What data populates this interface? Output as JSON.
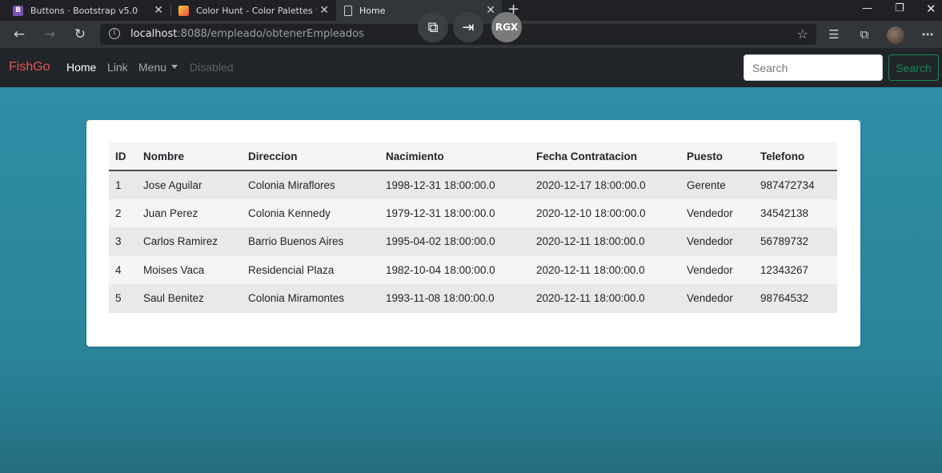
{
  "browser": {
    "tabs": [
      {
        "label": "Buttons · Bootstrap v5.0",
        "icon": "bootstrap-icon",
        "active": false
      },
      {
        "label": "Color Hunt - Color Palettes for D",
        "icon": "colorhunt-icon",
        "active": false
      },
      {
        "label": "Home",
        "icon": "page-icon",
        "active": true
      }
    ],
    "url_host": "localhost",
    "url_rest": ":8088/empleado/obtenerEmpleados",
    "overlay_rgx_label": "RGX"
  },
  "navbar": {
    "brand": "FishGo",
    "links": [
      "Home",
      "Link",
      "Menu",
      "Disabled"
    ],
    "search_placeholder": "Search",
    "search_button": "Search",
    "brand_color": "#e05757",
    "accent_color": "#198754"
  },
  "table": {
    "headers": [
      "ID",
      "Nombre",
      "Direccion",
      "Nacimiento",
      "Fecha Contratacion",
      "Puesto",
      "Telefono"
    ],
    "rows": [
      [
        "1",
        "Jose Aguilar",
        "Colonia Miraflores",
        "1998-12-31 18:00:00.0",
        "2020-12-17 18:00:00.0",
        "Gerente",
        "987472734"
      ],
      [
        "2",
        "Juan Perez",
        "Colonia Kennedy",
        "1979-12-31 18:00:00.0",
        "2020-12-10 18:00:00.0",
        "Vendedor",
        "34542138"
      ],
      [
        "3",
        "Carlos Ramirez",
        "Barrio Buenos Aires",
        "1995-04-02 18:00:00.0",
        "2020-12-11 18:00:00.0",
        "Vendedor",
        "56789732"
      ],
      [
        "4",
        "Moises Vaca",
        "Residencial Plaza",
        "1982-10-04 18:00:00.0",
        "2020-12-11 18:00:00.0",
        "Vendedor",
        "12343267"
      ],
      [
        "5",
        "Saul Benitez",
        "Colonia Miramontes",
        "1993-11-08 18:00:00.0",
        "2020-12-11 18:00:00.0",
        "Vendedor",
        "98764532"
      ]
    ]
  }
}
